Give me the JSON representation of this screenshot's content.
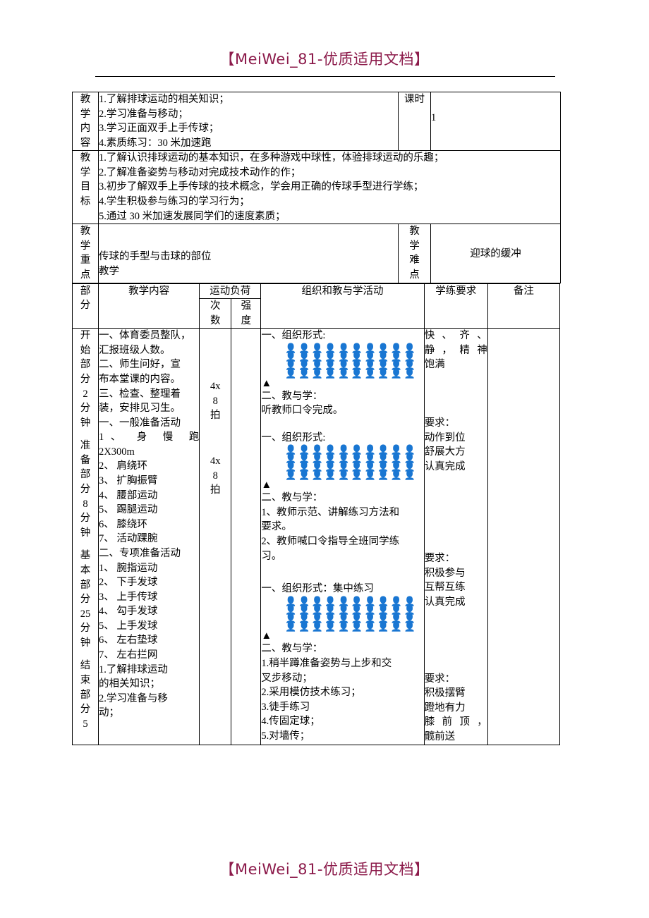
{
  "watermark": {
    "header": "【MeiWei_81-优质适用文档】",
    "footer": "【MeiWei_81-优质适用文档】",
    "color": "#8c1b4b"
  },
  "info_table": {
    "row_content": {
      "label": "教学内容",
      "items": [
        "1.了解排球运动的相关知识；",
        "2.学习准备与移动；",
        "3.学习正面双手上手传球；",
        "4.素质练习：30 米加速跑"
      ],
      "period_label": "课时",
      "period_value": "1"
    },
    "row_goal": {
      "label": "教学目标",
      "items": [
        "1.了解认识排球运动的基本知识，在多种游戏中球性，体验排球运动的乐趣；",
        "2.了解准备姿势与移动对完成技术动作的作；",
        "3.初步了解双手上手传球的技术概念，学会用正确的传球手型进行学练；",
        "4.学生积极参与练习的学习行为；",
        "5.通过 30 米加速发展同学们的速度素质；"
      ]
    },
    "row_key": {
      "label": "教学重点",
      "value_line1": "传球的手型与击球的部位",
      "value_line2": "教学",
      "hard_label": "教学难点",
      "hard_value": "迎球的缓冲"
    }
  },
  "schedule": {
    "headers": {
      "part": "部分",
      "content": "教学内容",
      "load": "运动负荷",
      "times": "次数",
      "intensity": "强度",
      "organization": "组织和教与学活动",
      "requirement": "学练要求",
      "note": "备注"
    },
    "parts": [
      {
        "chars": [
          "开",
          "始",
          "部",
          "分",
          "2",
          "分",
          "钟"
        ]
      },
      {
        "chars": [
          "准",
          "备",
          "部",
          "分",
          "8",
          "分",
          "钟"
        ]
      },
      {
        "chars": [
          "基",
          "本",
          "部",
          "分",
          "25",
          "分",
          "钟"
        ]
      },
      {
        "chars": [
          "结",
          "束",
          "部",
          "分",
          "5"
        ]
      }
    ],
    "content": {
      "begin": [
        "一、体育委员整队，",
        "汇报班级人数。",
        "二、师生问好，宣",
        "布本堂课的内容。",
        "三、检查、整理着",
        "装，安排见习生。"
      ],
      "prep_title": "一、一般准备活动",
      "prep_items_first": "1、 身 慢 跑",
      "prep_items_first_2": "2X300m",
      "prep_items": [
        "2、 肩绕环",
        "3、 扩胸振臂",
        "4、 腰部运动",
        "5、 踢腿运动",
        "6、 膝绕环",
        "7、 活动踝腕"
      ],
      "special_title": "二、专项准备活动",
      "special_items": [
        "1、 腕指运动",
        "2、 下手发球",
        "3、 上手传球",
        "4、 勾手发球",
        "5、 上手发球",
        "6、 左右垫球",
        "7、 左右拦网"
      ],
      "tail_items": [
        "1.了解排球运动",
        "的相关知识；",
        "2.学习准备与移",
        "动；"
      ]
    },
    "load": {
      "times": [
        "4x",
        "8",
        "拍",
        "4x",
        "8",
        "拍"
      ],
      "times_block1": [
        "4x",
        "8",
        "拍"
      ],
      "times_block2": [
        "4x",
        "8",
        "拍"
      ],
      "intensity": ""
    },
    "organization": {
      "block1": {
        "form_label": "一、组织形式:",
        "rows": 4,
        "cols": 10,
        "figure_glyph": "person-figure",
        "leader": "▲",
        "teach_label": "二、教与学：",
        "lines": [
          "  听教师口令完成。"
        ]
      },
      "block2": {
        "form_label": "一、组织形式:",
        "rows": 4,
        "cols": 10,
        "figure_glyph": "person-figure",
        "leader": "▲",
        "teach_label": "二、教与学：",
        "lines": [
          "1、教师示范、讲解练习方法和",
          "要求。",
          "2、教师喊口令指导全班同学练",
          "习。"
        ]
      },
      "block3": {
        "form_label": "一、组织形式：集中练习",
        "rows": 4,
        "cols": 10,
        "figure_glyph": "person-figure",
        "leader": "▲",
        "teach_label": "二、教与学：",
        "lines": [
          "1.稍半蹲准备姿势与上步和交",
          "叉步移动；",
          "2.采用模仿技术练习；",
          "3.徒手练习",
          "4.传固定球；",
          "5.对墙传；"
        ]
      }
    },
    "requirements": [
      {
        "lines": [
          "快、齐、",
          "静，精神",
          "饱满"
        ]
      },
      {
        "lines": [
          "要求：",
          "动作到位",
          "舒展大方",
          "认真完成"
        ]
      },
      {
        "lines": [
          "要求：",
          "积极参与",
          "互帮互练",
          "认真完成"
        ]
      },
      {
        "lines": [
          "要求：",
          "积极摆臂",
          "蹬地有力",
          "膝前顶，",
          "髋前送"
        ]
      }
    ],
    "note": ""
  }
}
